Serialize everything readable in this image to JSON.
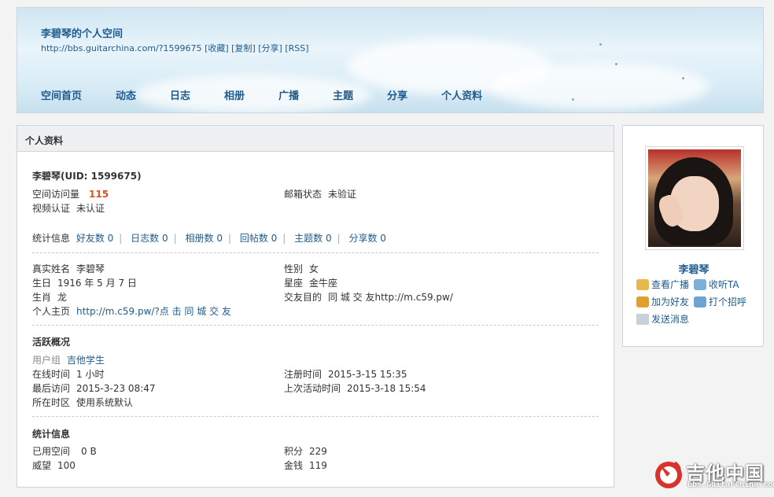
{
  "header": {
    "title": "李碧琴的个人空间",
    "url": "http://bbs.guitarchina.com/?1599675",
    "link_favorite": "[收藏]",
    "link_copy": "[复制]",
    "link_share": "[分享]",
    "link_rss": "[RSS]"
  },
  "nav": [
    "空间首页",
    "动态",
    "日志",
    "相册",
    "广播",
    "主题",
    "分享",
    "个人资料"
  ],
  "main": {
    "heading": "个人资料",
    "uid_line": "李碧琴(UID: 1599675)",
    "visits_label": "空间访问量",
    "visits_value": "115",
    "email_label": "邮箱状态",
    "email_value": "未验证",
    "video_label": "视频认证",
    "video_value": "未认证",
    "stats_label": "统计信息",
    "stats": [
      "好友数 0",
      "日志数 0",
      "相册数 0",
      "回帖数 0",
      "主题数 0",
      "分享数 0"
    ],
    "realname_label": "真实姓名",
    "realname_value": "李碧琴",
    "gender_label": "性别",
    "gender_value": "女",
    "birthday_label": "生日",
    "birthday_value": "1916 年 5 月 7 日",
    "constellation_label": "星座",
    "constellation_value": "金牛座",
    "zodiac_label": "生肖",
    "zodiac_value": "龙",
    "purpose_label": "交友目的",
    "purpose_value": "同 城 交 友http://m.c59.pw/",
    "homepage_label": "个人主页",
    "homepage_value": "http://m.c59.pw/?点 击 同 城 交 友",
    "activity_title": "活跃概况",
    "group_label": "用户组",
    "group_value": "吉他学生",
    "online_label": "在线时间",
    "online_value": "1 小时",
    "register_label": "注册时间",
    "register_value": "2015-3-15 15:35",
    "lastvisit_label": "最后访问",
    "lastvisit_value": "2015-3-23 08:47",
    "lastactive_label": "上次活动时间",
    "lastactive_value": "2015-3-18 15:54",
    "timezone_label": "所在时区",
    "timezone_value": "使用系统默认",
    "statinfo_title": "统计信息",
    "space_label": "已用空间",
    "space_value": "0 B",
    "points_label": "积分",
    "points_value": "229",
    "prestige_label": "威望",
    "prestige_value": "100",
    "money_label": "金钱",
    "money_value": "119"
  },
  "side": {
    "name": "李碧琴",
    "actions": {
      "broadcast": "查看广播",
      "follow": "收听TA",
      "add_friend": "加为好友",
      "greet": "打个招呼",
      "message": "发送消息"
    }
  },
  "watermark": {
    "text": "吉他中国",
    "sub": "bbs.GuitarChina.com"
  },
  "colors": {
    "link": "#1f5b8c",
    "accent": "#e04c1f"
  }
}
